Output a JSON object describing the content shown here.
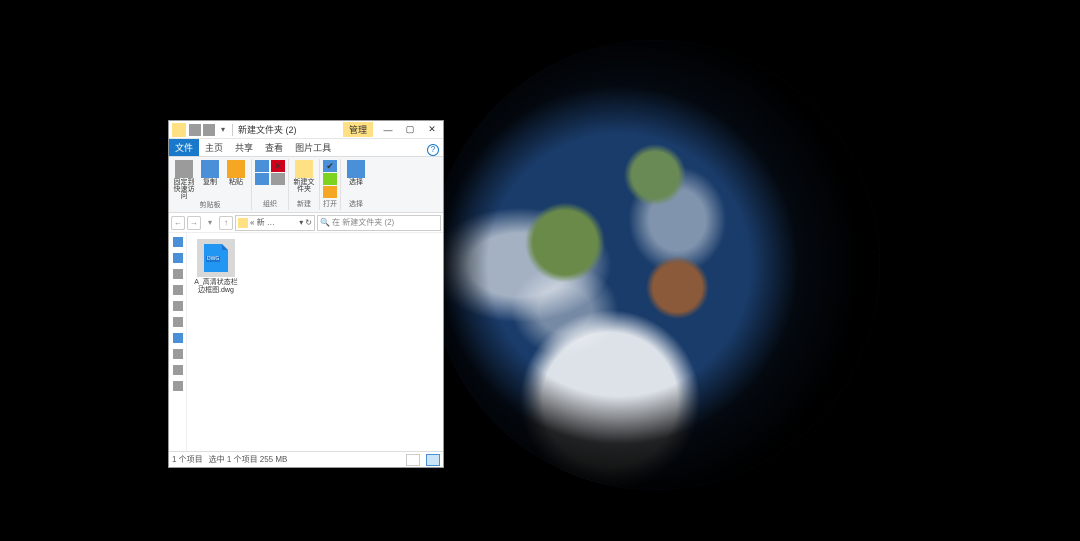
{
  "titlebar": {
    "title": "新建文件夹 (2)",
    "context_tab": "管理"
  },
  "window_controls": {
    "min": "—",
    "max": "▢",
    "close": "✕"
  },
  "tabs": [
    "文件",
    "主页",
    "共享",
    "查看",
    "图片工具"
  ],
  "help": "?",
  "ribbon": {
    "groups": [
      {
        "label": "剪贴板",
        "big": [
          {
            "name": "固定到快速访问",
            "icon": "pin-icon"
          },
          {
            "name": "复制",
            "icon": "copy-icon"
          },
          {
            "name": "粘贴",
            "icon": "paste-icon"
          }
        ]
      },
      {
        "label": "组织",
        "stack": [
          {
            "icon": "move-icon"
          },
          {
            "icon": "copyto-icon"
          },
          {
            "icon": "delete-icon"
          },
          {
            "icon": "rename-icon"
          }
        ]
      },
      {
        "label": "新建",
        "big": [
          {
            "name": "新建文件夹",
            "icon": "newfolder-icon"
          }
        ]
      },
      {
        "label": "打开",
        "stack": [
          {
            "icon": "properties-icon"
          },
          {
            "icon": "open-icon"
          },
          {
            "icon": "edit-icon"
          }
        ]
      },
      {
        "label": "选择",
        "big": [
          {
            "name": "选择",
            "icon": "select-icon"
          }
        ]
      }
    ]
  },
  "nav": {
    "back": "←",
    "fwd": "→",
    "up": "↑",
    "crumb": "« 新 …",
    "refresh": "↻",
    "search_glyph": "🔍",
    "search_placeholder": "在 新建文件夹 (2)"
  },
  "file": {
    "name": "A_高清状态栏边框图.dwg",
    "tag": "DWG"
  },
  "status": {
    "count": "1 个项目",
    "sel": "选中 1 个项目  255 MB"
  }
}
